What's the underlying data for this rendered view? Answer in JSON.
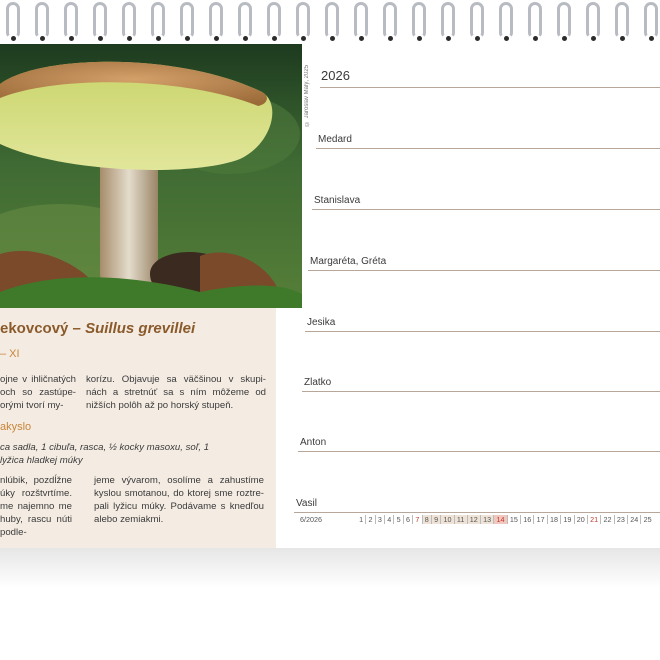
{
  "year": "2026",
  "copyright": "© Jaroslav Malý, 2025",
  "mushroom": {
    "name_local": "ekovcový",
    "dash": " – ",
    "name_latin": "Suillus grevillei",
    "season": "– XI",
    "text_left": "ojne v ihličnatých och so zastúpe- orými tvorí my-",
    "text_right": "korízu. Objavuje sa väčšinou v skupi- nách a stretnúť sa s ním môžeme od nižších polôh až po horský stupeň.",
    "recipe_title": "akyslo",
    "ingredients": "ca sadla, 1 cibuľa, rasca, ½ kocky masoxu, soľ, 1 lyžica hladkej múky",
    "steps_left": "nlúbik, pozdĺžne úky rozštvrtíme. me najemno me huby, rascu núti podle-",
    "steps_right": "jeme vývarom, osolíme a zahustíme kyslou smotanou, do ktorej sme roztre- pali lyžicu múky. Podávame s knedľou alebo zemiakmi."
  },
  "days": [
    {
      "name": "Medard"
    },
    {
      "name": "Stanislava"
    },
    {
      "name": "Margaréta, Gréta"
    },
    {
      "name": "Jesika"
    },
    {
      "name": "Zlatko"
    },
    {
      "name": "Anton"
    },
    {
      "name": "Vasil"
    }
  ],
  "month_strip": {
    "month_label": "6/2026",
    "days": [
      "1",
      "2",
      "3",
      "4",
      "5",
      "6",
      "7",
      "8",
      "9",
      "10",
      "11",
      "12",
      "13",
      "14",
      "15",
      "16",
      "17",
      "18",
      "19",
      "20",
      "21",
      "22",
      "23",
      "24",
      "25"
    ],
    "red_days": [
      "7",
      "14",
      "21"
    ],
    "shaded_days": [
      "8",
      "9",
      "10",
      "11",
      "12",
      "13",
      "14"
    ],
    "today": "14"
  },
  "colors": {
    "accent_brown": "#8a5a2b",
    "accent_orange": "#c8853a",
    "panel_beige": "#f4ece3",
    "weekend_red": "#c0392b",
    "line": "#b7a79a"
  }
}
